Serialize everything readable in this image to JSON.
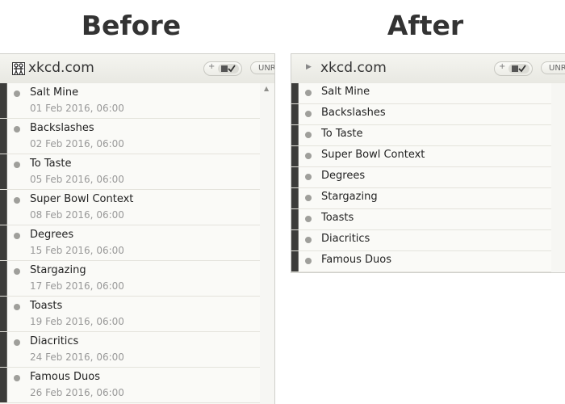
{
  "headings": {
    "before": "Before",
    "after": "After"
  },
  "colors": {
    "story_bar": "#3c3c3a",
    "unread_dot": "#9f9f9b",
    "panel_bg": "#f9f8f5"
  },
  "before": {
    "feed_title": "xkcd.com",
    "feed_icon": "xkcd-stick-figure-icon",
    "unread_label": "UNR",
    "stories": [
      {
        "title": "Salt Mine",
        "date": "01 Feb 2016, 06:00"
      },
      {
        "title": "Backslashes",
        "date": "02 Feb 2016, 06:00"
      },
      {
        "title": "To Taste",
        "date": "05 Feb 2016, 06:00"
      },
      {
        "title": "Super Bowl Context",
        "date": "08 Feb 2016, 06:00"
      },
      {
        "title": "Degrees",
        "date": "15 Feb 2016, 06:00"
      },
      {
        "title": "Stargazing",
        "date": "17 Feb 2016, 06:00"
      },
      {
        "title": "Toasts",
        "date": "19 Feb 2016, 06:00"
      },
      {
        "title": "Diacritics",
        "date": "24 Feb 2016, 06:00"
      },
      {
        "title": "Famous Duos",
        "date": "26 Feb 2016, 06:00"
      }
    ]
  },
  "after": {
    "feed_title": "xkcd.com",
    "unread_label": "UNR",
    "stories": [
      {
        "title": "Salt Mine"
      },
      {
        "title": "Backslashes"
      },
      {
        "title": "To Taste"
      },
      {
        "title": "Super Bowl Context"
      },
      {
        "title": "Degrees"
      },
      {
        "title": "Stargazing"
      },
      {
        "title": "Toasts"
      },
      {
        "title": "Diacritics"
      },
      {
        "title": "Famous Duos"
      }
    ]
  }
}
